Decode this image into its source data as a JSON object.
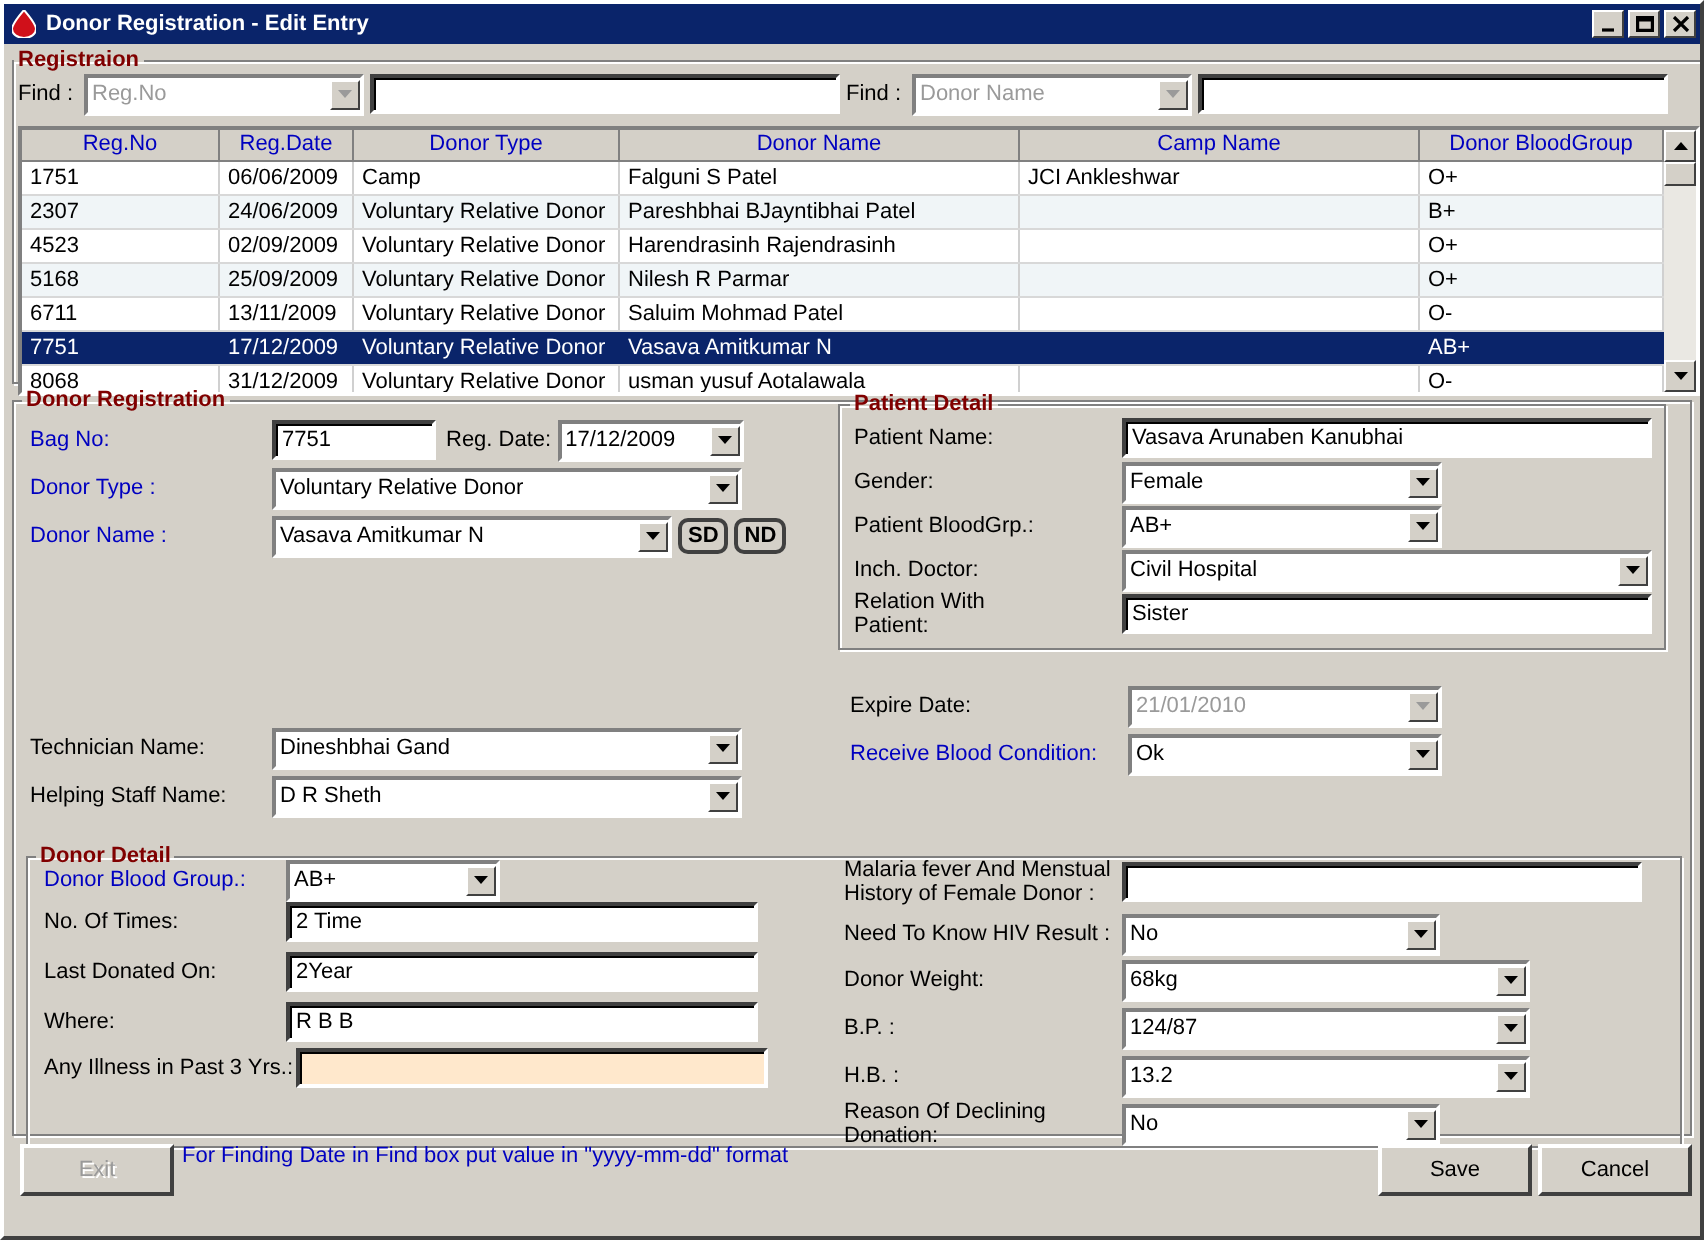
{
  "window": {
    "title": "Donor Registration - Edit Entry"
  },
  "registration": {
    "title": "Registraion",
    "find": [
      {
        "label": "Find :",
        "field": {
          "kind": "combo",
          "value": "Reg.No",
          "disabled": true
        }
      },
      {
        "label": "Find :",
        "field": {
          "kind": "combo",
          "value": "Donor Name",
          "disabled": true
        }
      }
    ],
    "table": {
      "columns": [
        "Reg.No",
        "Reg.Date",
        "Donor Type",
        "Donor Name",
        "Camp Name",
        "Donor BloodGroup"
      ],
      "rows": [
        {
          "cells": [
            "1751",
            "06/06/2009",
            "Camp",
            "Falguni S Patel",
            "JCI Ankleshwar",
            "O+"
          ],
          "selected": false
        },
        {
          "cells": [
            "2307",
            "24/06/2009",
            "Voluntary Relative Donor",
            "Pareshbhai BJayntibhai Patel",
            "",
            "B+"
          ],
          "selected": false
        },
        {
          "cells": [
            "4523",
            "02/09/2009",
            "Voluntary Relative Donor",
            "Harendrasinh Rajendrasinh",
            "",
            "O+"
          ],
          "selected": false
        },
        {
          "cells": [
            "5168",
            "25/09/2009",
            "Voluntary Relative Donor",
            "Nilesh R Parmar",
            "",
            "O+"
          ],
          "selected": false
        },
        {
          "cells": [
            "6711",
            "13/11/2009",
            "Voluntary Relative Donor",
            "Saluim Mohmad Patel",
            "",
            "O-"
          ],
          "selected": false
        },
        {
          "cells": [
            "7751",
            "17/12/2009",
            "Voluntary Relative Donor",
            "Vasava Amitkumar N",
            "",
            "AB+"
          ],
          "selected": true
        },
        {
          "cells": [
            "8068",
            "31/12/2009",
            "Voluntary Relative Donor",
            "usman yusuf Aotalawala",
            "",
            "O-"
          ],
          "selected": false
        }
      ]
    }
  },
  "donor_registration": {
    "title": "Donor Registration",
    "fields": [
      {
        "label": "Bag No:",
        "required": true,
        "kind": "text",
        "value": "7751",
        "extra": {
          "label": "Reg. Date:",
          "kind": "combo",
          "value": "17/12/2009"
        }
      },
      {
        "label": "Donor Type :",
        "required": true,
        "kind": "combo",
        "value": "Voluntary Relative Donor"
      },
      {
        "label": "Donor Name :",
        "required": true,
        "kind": "combo",
        "value": "Vasava Amitkumar N",
        "buttons": [
          "SD",
          "ND"
        ]
      }
    ],
    "staff": [
      {
        "label": "Technician Name:",
        "required": false,
        "kind": "combo",
        "value": "Dineshbhai Gand"
      },
      {
        "label": "Helping Staff  Name:",
        "required": false,
        "kind": "combo",
        "value": "D R Sheth"
      }
    ],
    "patient_detail": {
      "title": "Patient Detail",
      "fields": [
        {
          "label": "Patient Name:",
          "required": false,
          "kind": "text",
          "value": "Vasava Arunaben Kanubhai"
        },
        {
          "label": "Gender:",
          "required": false,
          "kind": "combo",
          "value": "Female"
        },
        {
          "label": "Patient BloodGrp.:",
          "required": false,
          "kind": "combo",
          "value": "AB+"
        },
        {
          "label": "Inch. Doctor:",
          "required": false,
          "kind": "combo",
          "value": "Civil Hospital"
        },
        {
          "label": "Relation With Patient:",
          "required": false,
          "kind": "text",
          "value": "Sister"
        }
      ]
    },
    "blood": [
      {
        "label": "Expire Date:",
        "required": false,
        "kind": "combo",
        "value": "21/01/2010",
        "disabled": true
      },
      {
        "label": "Receive Blood Condition:",
        "required": true,
        "kind": "combo",
        "value": "Ok"
      }
    ],
    "donor_detail": {
      "title": "Donor Detail",
      "left": [
        {
          "label": "Donor Blood Group.:",
          "required": true,
          "kind": "combo",
          "value": "AB+"
        },
        {
          "label": "No. Of Times:",
          "required": false,
          "kind": "text",
          "value": "2 Time"
        },
        {
          "label": "Last Donated On:",
          "required": false,
          "kind": "text",
          "value": "2Year"
        },
        {
          "label": "Where:",
          "required": false,
          "kind": "text",
          "value": "R B B"
        },
        {
          "label": "Any Illness in Past 3 Yrs.:",
          "required": false,
          "kind": "text",
          "focused": true
        }
      ],
      "right": [
        {
          "label": "Malaria fever And Menstual History of Female Donor  :",
          "required": false,
          "kind": "text"
        },
        {
          "label": "Need To Know HIV Result :",
          "required": false,
          "kind": "combo",
          "value": "No"
        },
        {
          "label": "Donor Weight:",
          "required": false,
          "kind": "combo",
          "value": "68kg"
        },
        {
          "label": "B.P. :",
          "required": false,
          "kind": "combo",
          "value": "124/87"
        },
        {
          "label": "H.B. :",
          "required": false,
          "kind": "combo",
          "value": "13.2"
        },
        {
          "label": "Reason Of Declining Donation:",
          "required": false,
          "kind": "combo",
          "value": "No"
        }
      ]
    }
  },
  "footer": {
    "exit": {
      "label": "Exit",
      "disabled": true
    },
    "note": "For Finding Date in Find box put value in \"yyyy-mm-dd\" format",
    "actions": [
      {
        "label": "Save",
        "disabled": false
      },
      {
        "label": "Cancel",
        "disabled": false
      }
    ]
  }
}
